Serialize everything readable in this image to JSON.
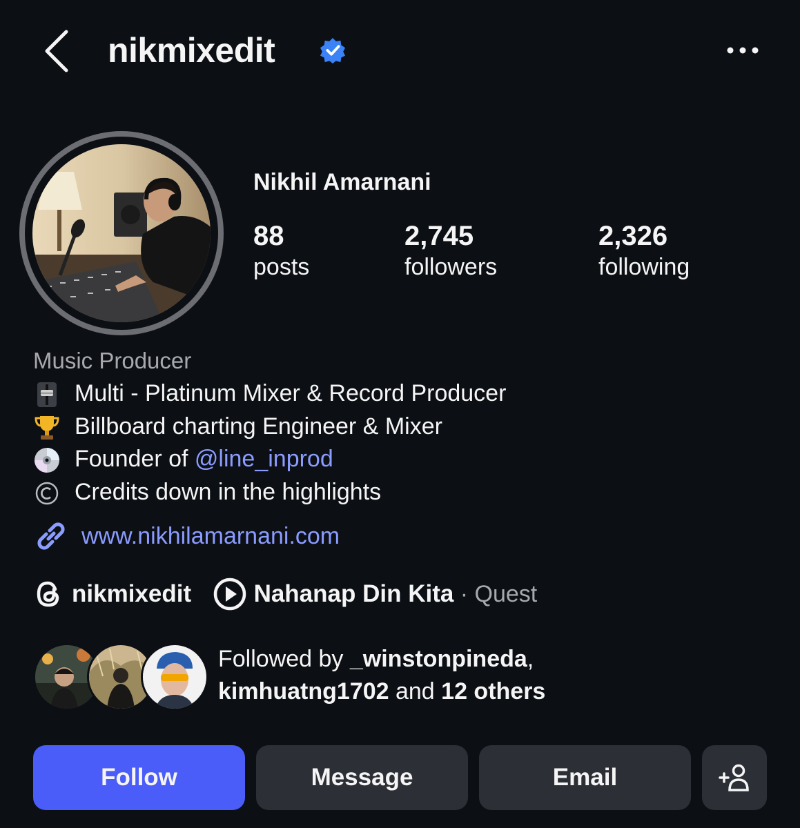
{
  "header": {
    "username": "nikmixedit",
    "verified": true
  },
  "profile": {
    "display_name": "Nikhil Amarnani",
    "stats": [
      {
        "value": "88",
        "label": "posts"
      },
      {
        "value": "2,745",
        "label": "followers"
      },
      {
        "value": "2,326",
        "label": "following"
      }
    ]
  },
  "bio": {
    "category": "Music Producer",
    "lines": [
      {
        "icon": "mixer-slider-icon",
        "text": "Multi - Platinum Mixer & Record Producer"
      },
      {
        "icon": "trophy-icon",
        "text": "Billboard charting Engineer & Mixer"
      },
      {
        "icon": "cd-icon",
        "prefix": "Founder of ",
        "mention": "@line_inprod"
      },
      {
        "icon": "copyright-icon",
        "text": "Credits down in the highlights"
      }
    ],
    "link": "www.nikhilamarnani.com"
  },
  "threads_row": {
    "threads_handle": "nikmixedit",
    "song": "Nahanap Din Kita",
    "separator": " · ",
    "artist": "Quest"
  },
  "followed_by": {
    "prefix": "Followed by ",
    "user1": "_winstonpineda",
    "comma": ",",
    "user2": "kimhuatng1702",
    "middle": " and ",
    "others": "12 others"
  },
  "actions": {
    "follow": "Follow",
    "message": "Message",
    "email": "Email"
  },
  "colors": {
    "background": "#0c0f14",
    "accent_button": "#4a5df9",
    "link": "#8b9cff",
    "secondary_button": "#2c2f35",
    "verified_badge": "#3b82f6"
  }
}
